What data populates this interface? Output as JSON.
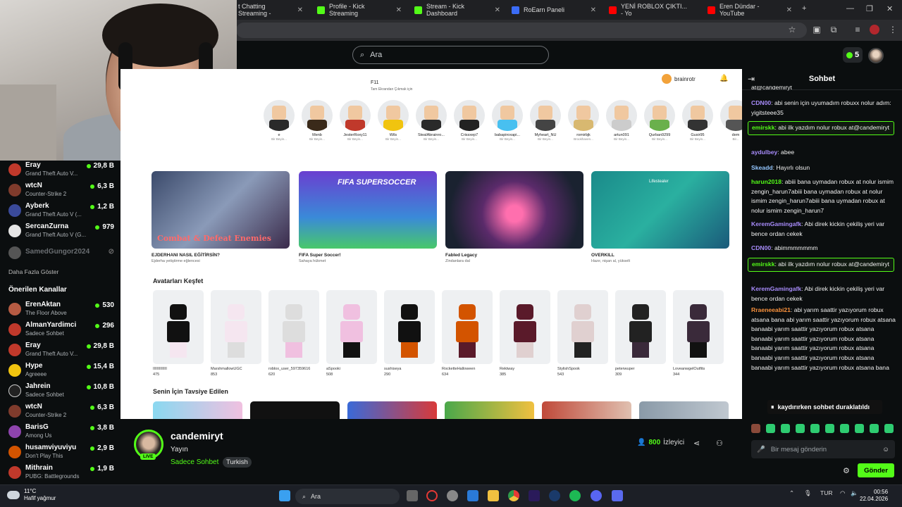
{
  "browser": {
    "tabs": [
      {
        "label": "t Chatting Streaming -",
        "color": "#53fc18"
      },
      {
        "label": "Profile - Kick Streaming",
        "color": "#53fc18"
      },
      {
        "label": "Stream - Kick Dashboard",
        "color": "#53fc18"
      },
      {
        "label": "RoEarn Paneli",
        "color": "#3b6cf6"
      },
      {
        "label": "YENİ ROBLOX ÇIKTI... - Yo",
        "color": "#ff0000"
      },
      {
        "label": "Eren Dündar - YouTube",
        "color": "#ff0000"
      }
    ]
  },
  "kick": {
    "search_placeholder": "Ara",
    "coins": "5"
  },
  "sidebar": {
    "top_channels": [
      {
        "name": "Eray",
        "category": "Grand Theft Auto V...",
        "viewers": "29,8 B"
      },
      {
        "name": "wtcN",
        "category": "Counter-Strike 2",
        "viewers": "6,3 B"
      },
      {
        "name": "Ayberk",
        "category": "Grand Theft Auto V (...",
        "viewers": "1,2 B"
      },
      {
        "name": "SercanZurna",
        "category": "Grand Theft Auto V (G...",
        "viewers": "979"
      }
    ],
    "offline_channel": "SamedGungor2024",
    "show_more": "Daha Fazla Göster",
    "recommended_title": "Önerilen Kanallar",
    "recommended": [
      {
        "name": "ErenAktan",
        "category": "The Floor Above",
        "viewers": "530"
      },
      {
        "name": "AlmanYardimci",
        "category": "Sadece Sohbet",
        "viewers": "296"
      },
      {
        "name": "Eray",
        "category": "Grand Theft Auto V...",
        "viewers": "29,8 B"
      },
      {
        "name": "Hype",
        "category": "Agreeee",
        "viewers": "15,4 B"
      },
      {
        "name": "Jahrein",
        "category": "Sadece Sohbet",
        "viewers": "10,8 B"
      },
      {
        "name": "wtcN",
        "category": "Counter-Strike 2",
        "viewers": "6,3 B"
      },
      {
        "name": "BarisG",
        "category": "Among Us",
        "viewers": "3,8 B"
      },
      {
        "name": "husamviyuviyu",
        "category": "Don't Play This",
        "viewers": "2,9 B"
      },
      {
        "name": "Mithrain",
        "category": "PUBG: Battlegrounds",
        "viewers": "1,9 B"
      }
    ]
  },
  "roblox": {
    "f11_title": "F11",
    "f11_sub": "Tam Ekrandan Çıkmak için",
    "username": "brainrotr",
    "friends": [
      {
        "name": "e",
        "status": "Bir Beyin..."
      },
      {
        "name": "Menb",
        "status": "Bir Beyin..."
      },
      {
        "name": "JesterRoxy11",
        "status": "Bir Beyin..."
      },
      {
        "name": "Wils",
        "status": "Bir Beyin..."
      },
      {
        "name": "StealAbrainro...",
        "status": "Bir Beyin..."
      },
      {
        "name": "Crissxep7",
        "status": "Bir Beyin..."
      },
      {
        "name": "babapiroxapi...",
        "status": "Bir Beyin..."
      },
      {
        "name": "Myheart_NU",
        "status": "Bir Beyin..."
      },
      {
        "name": "romirbjk",
        "status": "Brookhaven..."
      },
      {
        "name": "artun091",
        "status": "Bir Beyin..."
      },
      {
        "name": "Qurban9299",
        "status": "Bir Beyin..."
      },
      {
        "name": "Gusir95",
        "status": "Bir Beyin..."
      },
      {
        "name": "dem",
        "status": "Bir..."
      }
    ],
    "games": [
      {
        "title": "EJDERHANI NASIL EĞİTİRSİN?",
        "desc": "Ejderha yetiştirme eğlencesi",
        "overlay": "Combat & Defeat Enemies"
      },
      {
        "title": "FIFA Super Soccer!",
        "desc": "Sahaya hükmet",
        "overlay": "FIFA SUPERSOCCER"
      },
      {
        "title": "Fabled Legacy",
        "desc": "Zindanlara dal",
        "overlay": ""
      },
      {
        "title": "OVERKILL",
        "desc": "Hazır, nişan al, yükselt",
        "overlay": "Lifestealer"
      }
    ],
    "avatars_title": "Avatarları Keşfet",
    "avatars": [
      {
        "name": "IIIIIIIIIIIII",
        "price": "475"
      },
      {
        "name": "MarshmallowUGC",
        "price": "853"
      },
      {
        "name": "roblox_user_597359616",
        "price": "620"
      },
      {
        "name": "aSpooki",
        "price": "508"
      },
      {
        "name": "sushiseya",
        "price": "290"
      },
      {
        "name": "RocketteHalloween",
        "price": "634"
      },
      {
        "name": "Rektway",
        "price": "385"
      },
      {
        "name": "StylishSpook",
        "price": "543"
      },
      {
        "name": "peterwuper",
        "price": "309"
      },
      {
        "name": "LoveanwgelOutfits",
        "price": "344"
      }
    ],
    "recommended_title": "Senin İçin Tavsiye Edilen"
  },
  "stream": {
    "streamer": "candemiryt",
    "live": "LIVE",
    "title": "Yayın",
    "category": "Sadece Sohbet",
    "tag": "Turkish",
    "viewers_count": "800",
    "viewers_label": "İzleyici"
  },
  "chat": {
    "title": "Sohbet",
    "messages": [
      {
        "user": "",
        "text": "at@candemiryt",
        "color": "#ffffff",
        "hl": false
      },
      {
        "user": "CDN00",
        "text": "abi senin için uyumadım robuxx nolur adım: yigitsteee35",
        "color": "#a78bfa",
        "hl": false
      },
      {
        "user": "emirskk",
        "text": "abi ilk yazdım nolur robux at@candemiryt",
        "color": "#53fc18",
        "hl": true
      },
      {
        "user": "aydulbey",
        "text": "abee",
        "color": "#a78bfa",
        "hl": false
      },
      {
        "user": "Skeadd",
        "text": "Hayırlı olsun",
        "color": "#93c5fd",
        "hl": false
      },
      {
        "user": "harun2018",
        "text": "abiii bana uymadan robux at nolur ismim zengin_harun7abiii bana uymadan robux at nolur ismim zengin_harun7abiii bana uymadan robux at nolur ismim zengin_harun7",
        "color": "#53fc18",
        "hl": false
      },
      {
        "user": "KeremGamingafk",
        "text": "Abi direk kickin çekiliş yeri var bence ordan cekek",
        "color": "#a78bfa",
        "hl": false
      },
      {
        "user": "CDN00",
        "text": "abimmmmmmm",
        "color": "#a78bfa",
        "hl": false
      },
      {
        "user": "emirskk",
        "text": "abi ilk yazdım nolur robux at@candemiryt",
        "color": "#53fc18",
        "hl": true
      },
      {
        "user": "KeremGamingafk",
        "text": "Abi direk kickin çekiliş yeri var bence ordan cekek",
        "color": "#a78bfa",
        "hl": false
      },
      {
        "user": "Rraeneeabi21",
        "text": "abi yarım saattir yazıyorum robux atsana bana abi yarım saattir yazıyorum robux atsana banaabi yarım saattir yazıyorum robux atsana banaabi yarım saattir yazıyorum robux atsana banaabi yarım saattir yazıyorum robux atsana banaabi yarım saattir yazıyorum robux atsana banaabi yarım saattir yazıyorum robux atsana bana",
        "color": "#fb923c",
        "hl": false
      }
    ],
    "pause_label": "kaydırırken sohbet duraklatıldı",
    "input_placeholder": "Bir mesaj gönderin",
    "send_label": "Gönder"
  },
  "taskbar": {
    "temp": "11°C",
    "weather": "Hafif yağmur",
    "search": "Ara",
    "lang": "TUR",
    "time": "00:56",
    "date": "22.04.2026"
  }
}
